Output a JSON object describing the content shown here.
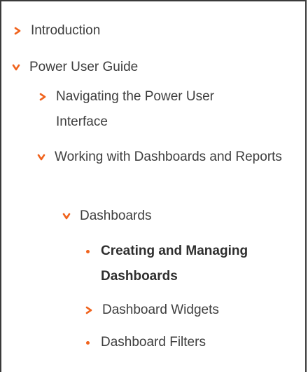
{
  "accent_color": "#f0631d",
  "text_color": "#3d3d3d",
  "toc": {
    "items": [
      {
        "label": "Introduction",
        "icon": "chevron-right-icon"
      },
      {
        "label": "Power User Guide",
        "icon": "chevron-down-icon"
      },
      {
        "label": "Navigating the Power User Interface",
        "icon": "chevron-right-icon"
      },
      {
        "label": "Working with Dashboards and Reports",
        "icon": "chevron-down-icon"
      },
      {
        "label": "Dashboards",
        "icon": "chevron-down-icon"
      },
      {
        "label": "Creating and Managing Dashboards",
        "icon": "bullet-icon",
        "current": true
      },
      {
        "label": "Dashboard Widgets",
        "icon": "chevron-right-icon"
      },
      {
        "label": "Dashboard Filters",
        "icon": "bullet-icon"
      }
    ]
  }
}
